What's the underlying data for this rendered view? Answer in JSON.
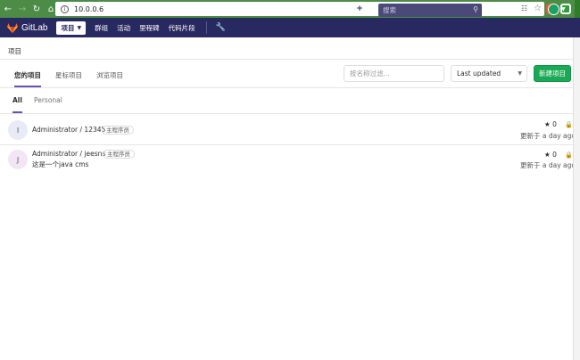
{
  "browser": {
    "url": "10.0.0.6"
  },
  "header": {
    "brand": "GitLab",
    "projects_label": "项目",
    "nav": [
      "群组",
      "活动",
      "里程碑",
      "代码片段"
    ],
    "search_placeholder": "搜索"
  },
  "breadcrumb": "项目",
  "tabs": [
    {
      "label": "您的项目",
      "active": true
    },
    {
      "label": "星标项目",
      "active": false
    },
    {
      "label": "浏览项目",
      "active": false
    }
  ],
  "filter": {
    "placeholder": "按名称过滤..."
  },
  "sort": {
    "selected": "Last updated"
  },
  "new_project_label": "新建项目",
  "subtabs": [
    {
      "label": "All",
      "active": true
    },
    {
      "label": "Personal",
      "active": false
    }
  ],
  "projects": [
    {
      "avatar_letter": "I",
      "avatar_color": "#e8eaf6",
      "name": "Administrator / 12345",
      "role": "主程序员",
      "description": "",
      "stars": "0",
      "updated": "更新于 a day ago"
    },
    {
      "avatar_letter": "J",
      "avatar_color": "#f3e5f5",
      "name": "Administrator / jeesns",
      "role": "主程序员",
      "description": "这是一个java cms",
      "stars": "0",
      "updated": "更新于 a day ago"
    }
  ],
  "colors": {
    "browser_bar": "#4c8c46",
    "header_bg": "#292961",
    "accent": "#6b4fbb",
    "new_button": "#1aaa55"
  }
}
